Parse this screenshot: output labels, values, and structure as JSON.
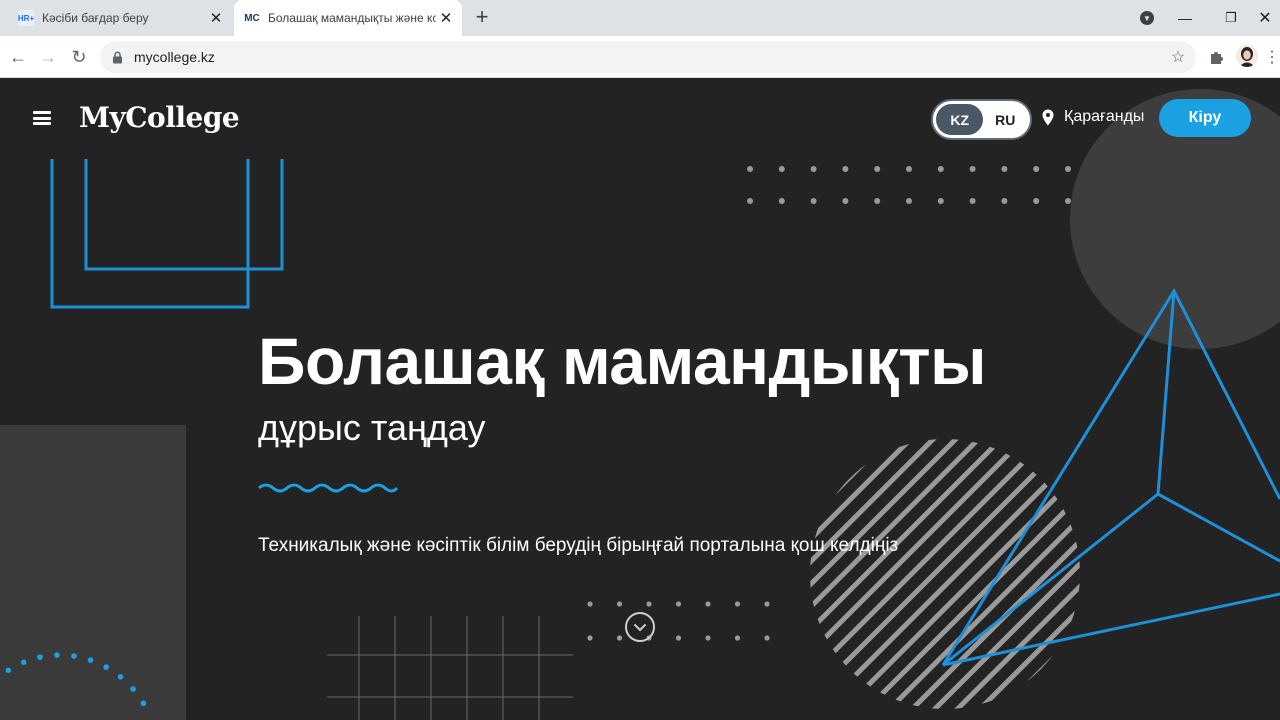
{
  "browser": {
    "tabs": [
      {
        "favicon": "HR+",
        "title": "Кәсіби бағдар беру",
        "active": false
      },
      {
        "favicon": "MC",
        "title": "Болашақ мамандықты және кол",
        "active": true
      }
    ],
    "url": "mycollege.kz",
    "icons": {
      "close": "✕",
      "new_tab": "+",
      "back": "←",
      "forward": "→",
      "reload": "↻",
      "star": "☆",
      "extensions": "puzzle-icon",
      "menu": "⋮",
      "minimize": "—",
      "maximize": "❐",
      "window_close": "✕",
      "profile": "▼"
    }
  },
  "site": {
    "logo": "MyCollege",
    "languages": [
      "KZ",
      "RU"
    ],
    "active_language": "KZ",
    "city": "Қарағанды",
    "login_label": "Кіру"
  },
  "hero": {
    "title": "Болашақ мамандықты",
    "subtitle": "дұрыс таңдау",
    "welcome": "Техникалық және кәсіптік білім берудің бірыңғай порталына қош келдіңіз"
  },
  "colors": {
    "page_bg": "#232323",
    "accent_blue": "#1ba1e2",
    "line_blue": "#1e90d8",
    "panel_gray": "#3a3a3a",
    "lang_active_bg": "#4a5866"
  }
}
